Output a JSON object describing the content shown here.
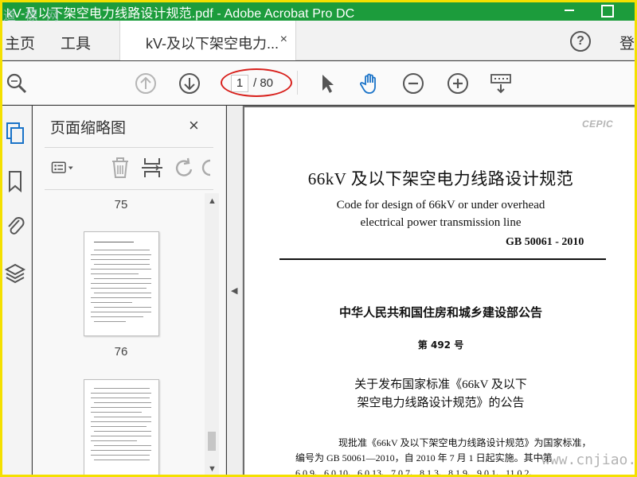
{
  "window": {
    "title": "kV-及以下架空电力线路设计规范.pdf - Adobe Acrobat Pro DC"
  },
  "menu": {
    "home": "主页",
    "tools": "工具",
    "tab_label": "kV-及以下架空电力...",
    "tab_close": "×",
    "help": "?",
    "login": "登"
  },
  "toolbar": {
    "current_page": "1",
    "total_pages": "/ 80",
    "icons": [
      "zoom-search-icon",
      "page-up-icon",
      "page-down-icon",
      "select-arrow-icon",
      "hand-tool-icon",
      "zoom-out-icon",
      "zoom-in-icon",
      "marquee-zoom-icon"
    ]
  },
  "sidebar": {
    "icons": [
      "page-thumbnails-icon",
      "bookmark-icon",
      "attachment-icon",
      "layers-icon"
    ]
  },
  "thumbnails": {
    "title": "页面缩略图",
    "close": "×",
    "pages": [
      {
        "number": "75"
      },
      {
        "number": "76"
      }
    ]
  },
  "document": {
    "logo": "CEPIC",
    "title": "66kV 及以下架空电力线路设计规范",
    "title_en_line1": "Code for design of 66kV or under overhead",
    "title_en_line2": "electrical power transmission line",
    "code": "GB 50061 - 2010",
    "ministry": "中华人民共和国住房和城乡建设部公告",
    "number": "第 492 号",
    "heading_line1": "关于发布国家标准《66kV 及以下",
    "heading_line2": "架空电力线路设计规范》的公告",
    "body_line1": "现批准《66kV 及以下架空电力线路设计规范》为国家标准，",
    "body_line2": "编号为 GB 50061—2010，自 2010 年 7 月 1 日起实施。其中第",
    "body_line3": "6.0.9、6.0.10、6.0.13、7.0.7、8.1.3、8.1.9、9.0.1、11.0.2、"
  },
  "watermarks": {
    "top_left": "道 標 网",
    "bottom_right": "www.cnjiao.com"
  },
  "colors": {
    "titlebar": "#1c9c3c",
    "frame": "#f4e000",
    "annotation": "#d8201c",
    "hand_tool": "#1a73c8"
  }
}
